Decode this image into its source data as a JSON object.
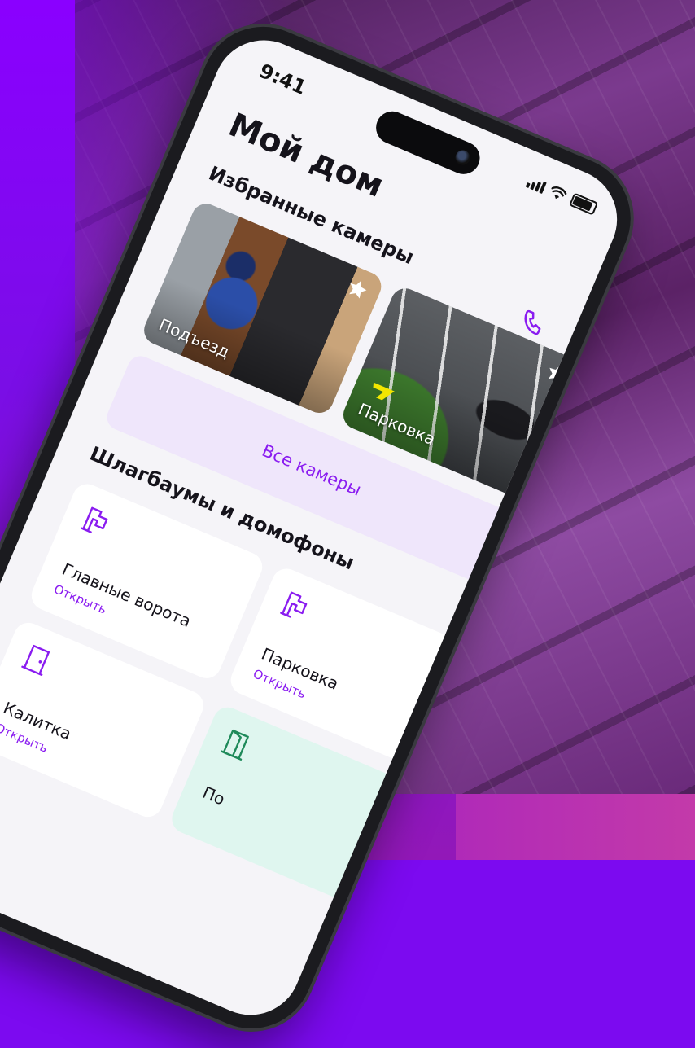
{
  "status_bar": {
    "time": "9:41"
  },
  "header": {
    "title": "Мой дом"
  },
  "favorites": {
    "title": "Избранные камеры",
    "cameras": [
      {
        "label": "Подъезд"
      },
      {
        "label": "Парковка"
      }
    ],
    "all_cameras_label": "Все камеры"
  },
  "barriers": {
    "title": "Шлагбаумы и домофоны",
    "items": [
      {
        "name": "Главные ворота",
        "action": "Открыть",
        "icon": "intercom-icon"
      },
      {
        "name": "Парковка",
        "action": "Открыть",
        "icon": "intercom-icon"
      },
      {
        "name": "Калитка",
        "action": "Открыть",
        "icon": "door-icon"
      },
      {
        "name": "По",
        "action": "",
        "icon": "door-open-icon"
      }
    ]
  },
  "colors": {
    "accent": "#8a1cf0",
    "background_purple": "#7c0af0",
    "tile_mint": "#dff6ef",
    "button_bg": "#efe6fb"
  }
}
